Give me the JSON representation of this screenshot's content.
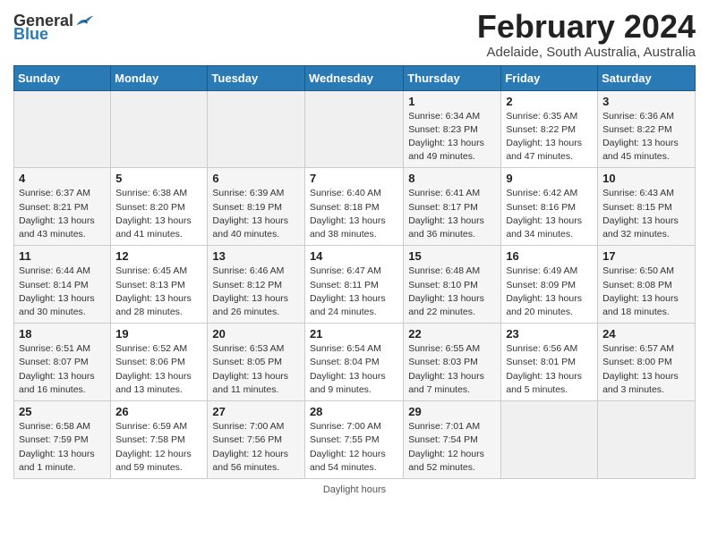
{
  "header": {
    "logo_general": "General",
    "logo_blue": "Blue",
    "title": "February 2024",
    "subtitle": "Adelaide, South Australia, Australia"
  },
  "weekdays": [
    "Sunday",
    "Monday",
    "Tuesday",
    "Wednesday",
    "Thursday",
    "Friday",
    "Saturday"
  ],
  "weeks": [
    [
      {
        "day": "",
        "detail": ""
      },
      {
        "day": "",
        "detail": ""
      },
      {
        "day": "",
        "detail": ""
      },
      {
        "day": "",
        "detail": ""
      },
      {
        "day": "1",
        "detail": "Sunrise: 6:34 AM\nSunset: 8:23 PM\nDaylight: 13 hours\nand 49 minutes."
      },
      {
        "day": "2",
        "detail": "Sunrise: 6:35 AM\nSunset: 8:22 PM\nDaylight: 13 hours\nand 47 minutes."
      },
      {
        "day": "3",
        "detail": "Sunrise: 6:36 AM\nSunset: 8:22 PM\nDaylight: 13 hours\nand 45 minutes."
      }
    ],
    [
      {
        "day": "4",
        "detail": "Sunrise: 6:37 AM\nSunset: 8:21 PM\nDaylight: 13 hours\nand 43 minutes."
      },
      {
        "day": "5",
        "detail": "Sunrise: 6:38 AM\nSunset: 8:20 PM\nDaylight: 13 hours\nand 41 minutes."
      },
      {
        "day": "6",
        "detail": "Sunrise: 6:39 AM\nSunset: 8:19 PM\nDaylight: 13 hours\nand 40 minutes."
      },
      {
        "day": "7",
        "detail": "Sunrise: 6:40 AM\nSunset: 8:18 PM\nDaylight: 13 hours\nand 38 minutes."
      },
      {
        "day": "8",
        "detail": "Sunrise: 6:41 AM\nSunset: 8:17 PM\nDaylight: 13 hours\nand 36 minutes."
      },
      {
        "day": "9",
        "detail": "Sunrise: 6:42 AM\nSunset: 8:16 PM\nDaylight: 13 hours\nand 34 minutes."
      },
      {
        "day": "10",
        "detail": "Sunrise: 6:43 AM\nSunset: 8:15 PM\nDaylight: 13 hours\nand 32 minutes."
      }
    ],
    [
      {
        "day": "11",
        "detail": "Sunrise: 6:44 AM\nSunset: 8:14 PM\nDaylight: 13 hours\nand 30 minutes."
      },
      {
        "day": "12",
        "detail": "Sunrise: 6:45 AM\nSunset: 8:13 PM\nDaylight: 13 hours\nand 28 minutes."
      },
      {
        "day": "13",
        "detail": "Sunrise: 6:46 AM\nSunset: 8:12 PM\nDaylight: 13 hours\nand 26 minutes."
      },
      {
        "day": "14",
        "detail": "Sunrise: 6:47 AM\nSunset: 8:11 PM\nDaylight: 13 hours\nand 24 minutes."
      },
      {
        "day": "15",
        "detail": "Sunrise: 6:48 AM\nSunset: 8:10 PM\nDaylight: 13 hours\nand 22 minutes."
      },
      {
        "day": "16",
        "detail": "Sunrise: 6:49 AM\nSunset: 8:09 PM\nDaylight: 13 hours\nand 20 minutes."
      },
      {
        "day": "17",
        "detail": "Sunrise: 6:50 AM\nSunset: 8:08 PM\nDaylight: 13 hours\nand 18 minutes."
      }
    ],
    [
      {
        "day": "18",
        "detail": "Sunrise: 6:51 AM\nSunset: 8:07 PM\nDaylight: 13 hours\nand 16 minutes."
      },
      {
        "day": "19",
        "detail": "Sunrise: 6:52 AM\nSunset: 8:06 PM\nDaylight: 13 hours\nand 13 minutes."
      },
      {
        "day": "20",
        "detail": "Sunrise: 6:53 AM\nSunset: 8:05 PM\nDaylight: 13 hours\nand 11 minutes."
      },
      {
        "day": "21",
        "detail": "Sunrise: 6:54 AM\nSunset: 8:04 PM\nDaylight: 13 hours\nand 9 minutes."
      },
      {
        "day": "22",
        "detail": "Sunrise: 6:55 AM\nSunset: 8:03 PM\nDaylight: 13 hours\nand 7 minutes."
      },
      {
        "day": "23",
        "detail": "Sunrise: 6:56 AM\nSunset: 8:01 PM\nDaylight: 13 hours\nand 5 minutes."
      },
      {
        "day": "24",
        "detail": "Sunrise: 6:57 AM\nSunset: 8:00 PM\nDaylight: 13 hours\nand 3 minutes."
      }
    ],
    [
      {
        "day": "25",
        "detail": "Sunrise: 6:58 AM\nSunset: 7:59 PM\nDaylight: 13 hours\nand 1 minute."
      },
      {
        "day": "26",
        "detail": "Sunrise: 6:59 AM\nSunset: 7:58 PM\nDaylight: 12 hours\nand 59 minutes."
      },
      {
        "day": "27",
        "detail": "Sunrise: 7:00 AM\nSunset: 7:56 PM\nDaylight: 12 hours\nand 56 minutes."
      },
      {
        "day": "28",
        "detail": "Sunrise: 7:00 AM\nSunset: 7:55 PM\nDaylight: 12 hours\nand 54 minutes."
      },
      {
        "day": "29",
        "detail": "Sunrise: 7:01 AM\nSunset: 7:54 PM\nDaylight: 12 hours\nand 52 minutes."
      },
      {
        "day": "",
        "detail": ""
      },
      {
        "day": "",
        "detail": ""
      }
    ]
  ],
  "footer": "Daylight hours"
}
